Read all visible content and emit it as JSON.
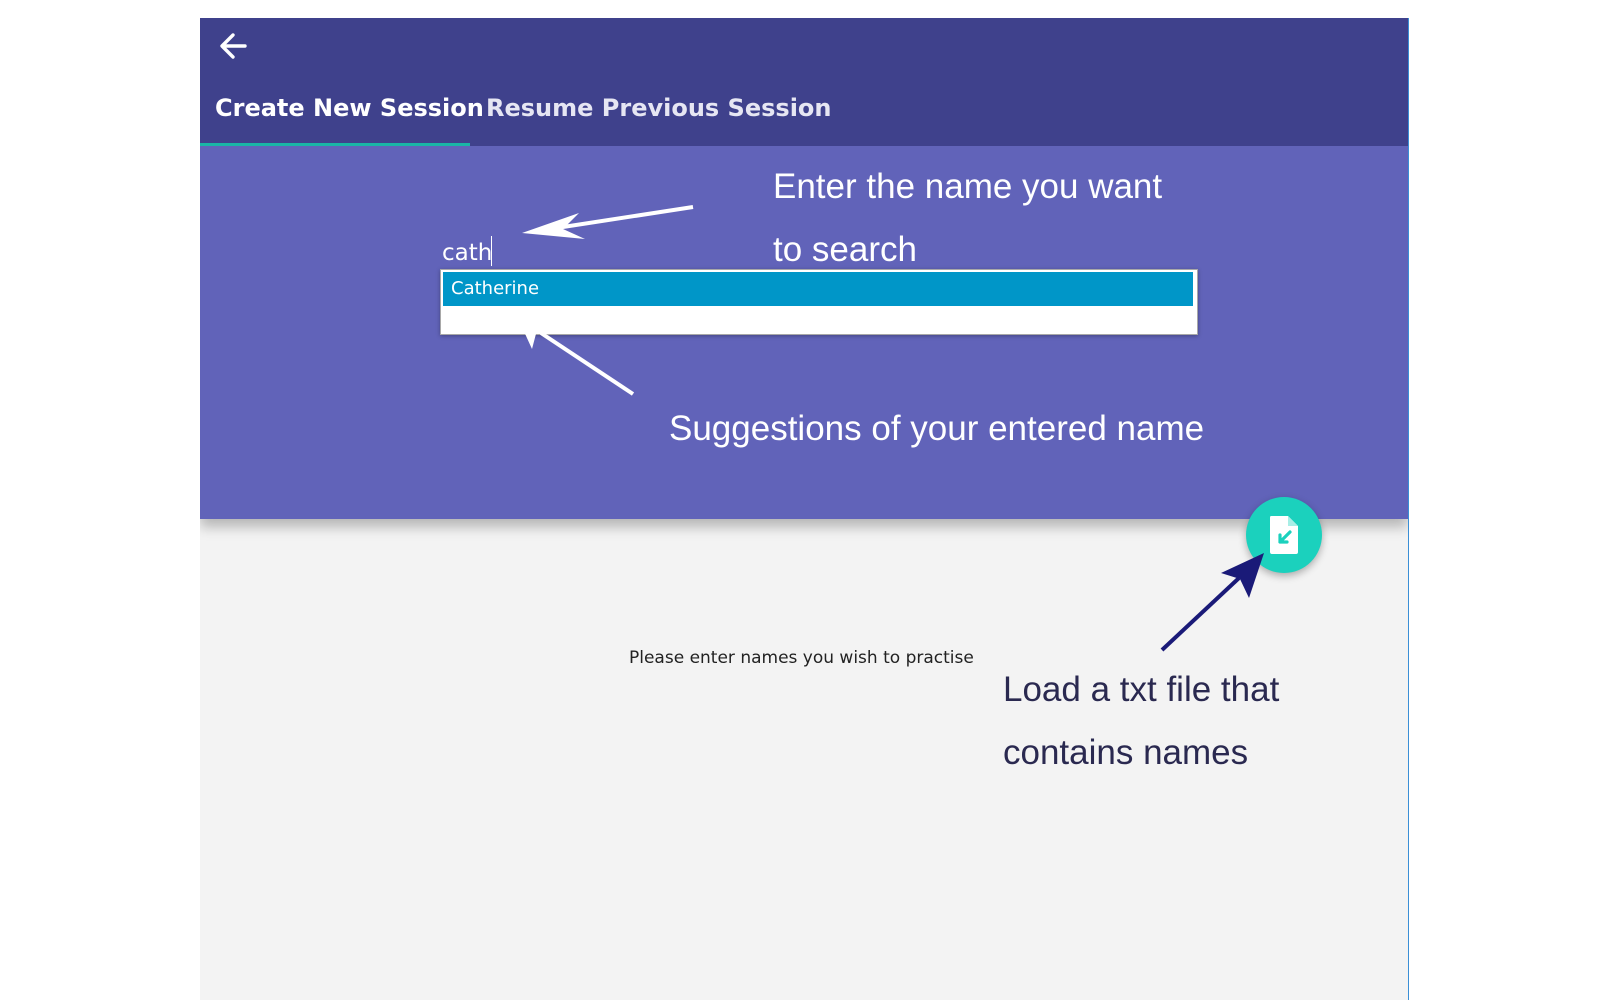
{
  "header": {
    "back_icon": "arrow-left-icon",
    "tabs": [
      {
        "label": "Create New Session",
        "active": true
      },
      {
        "label": "Resume Previous Session",
        "active": false
      }
    ]
  },
  "search": {
    "value": "cath",
    "suggestions": [
      "Catherine"
    ]
  },
  "main": {
    "hint": "Please enter names you wish to practise",
    "fab_icon": "file-import-icon"
  },
  "annotations": {
    "enter_name": [
      "Enter the name you want",
      "to search"
    ],
    "suggestions": "Suggestions of your entered name",
    "load_file": [
      "Load a txt file that",
      "contains names"
    ]
  },
  "colors": {
    "header_bg": "#3f418c",
    "banner_bg": "#6163b9",
    "tab_indicator": "#19b5a6",
    "suggestion_highlight": "#0096c8",
    "fab": "#1bd1bd",
    "body_bg": "#f3f3f3"
  }
}
